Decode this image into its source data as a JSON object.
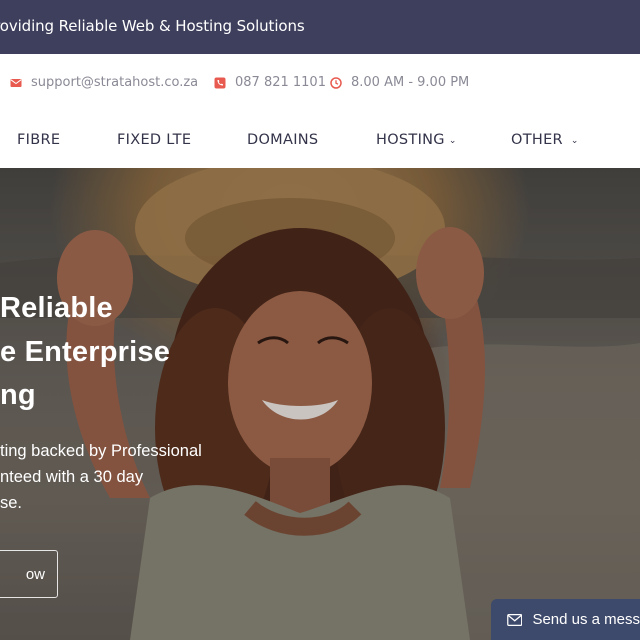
{
  "topbar": {
    "tagline": "roviding Reliable Web & Hosting Solutions"
  },
  "contact": {
    "email": "support@stratahost.co.za",
    "phone": "087 821 1101",
    "hours": "8.00 AM - 9.00 PM"
  },
  "nav": {
    "items": [
      {
        "label": "FIBRE"
      },
      {
        "label": "FIXED LTE"
      },
      {
        "label": "DOMAINS"
      },
      {
        "label": "HOSTING"
      },
      {
        "label": "OTHER"
      }
    ]
  },
  "hero": {
    "heading_lines": [
      "Reliable",
      "e Enterprise",
      "ng"
    ],
    "body_lines": [
      "ting backed by Professional",
      "nteed with a 30 day",
      "se."
    ],
    "cta_label": "ow"
  },
  "chat_widget": {
    "label": "Send us a mess"
  },
  "colors": {
    "topbar_bg": "#3e3f5c",
    "icon_accent": "#e85a4f",
    "nav_text": "#33334a",
    "widget_bg": "#3e4a6b"
  }
}
